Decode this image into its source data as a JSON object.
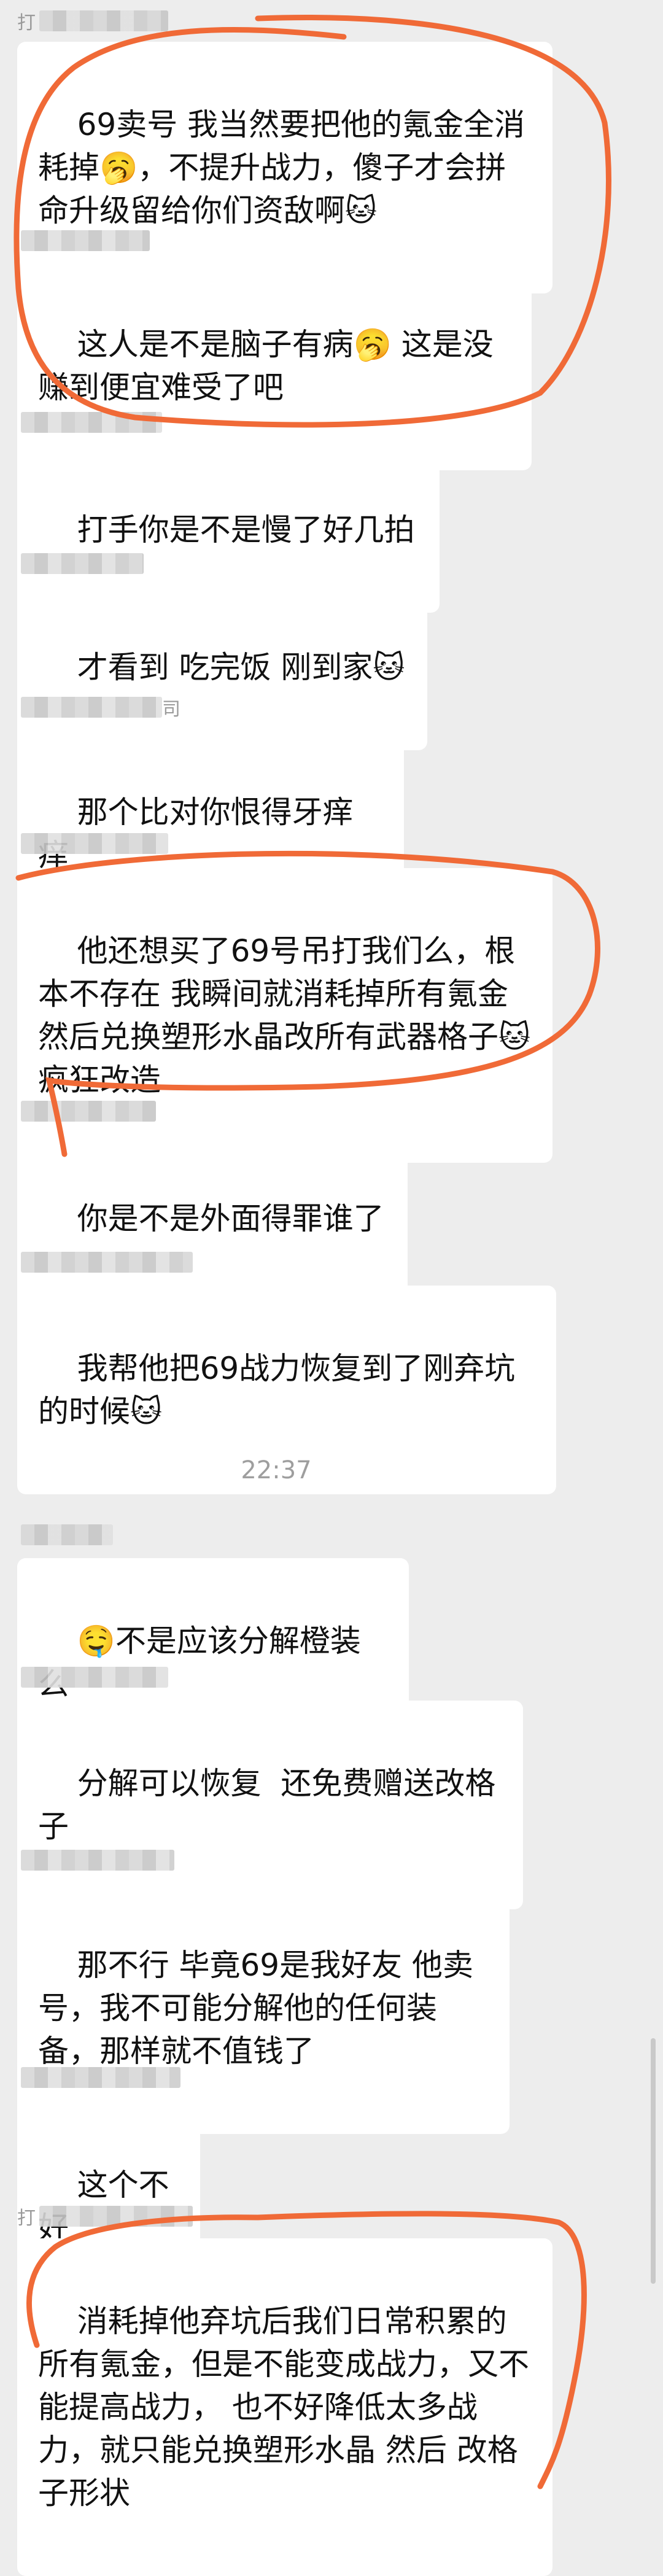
{
  "colors": {
    "background": "#ededed",
    "bubble": "#ffffff",
    "annotation": "#f06a37"
  },
  "timestamp": "22:37",
  "messages": [
    {
      "sender_visible": "打",
      "text": "69卖号 我当然要把他的氪金全消耗掉🥱，不提升战力，傻子才会拼命升级留给你们资敌啊🐱"
    },
    {
      "sender_visible": "",
      "text": "这人是不是脑子有病🥱 这是没赚到便宜难受了吧"
    },
    {
      "sender_visible": "",
      "text": "打手你是不是慢了好几拍"
    },
    {
      "sender_visible": "",
      "text": "才看到 吃完饭 刚到家🐱"
    },
    {
      "sender_visible": "司",
      "text": "那个比对你恨得牙痒痒"
    },
    {
      "sender_visible": "",
      "text": "他还想买了69号吊打我们么，根本不存在 我瞬间就消耗掉所有氪金 然后兑换塑形水晶改所有武器格子🐱疯狂改造"
    },
    {
      "sender_visible": "",
      "text": "你是不是外面得罪谁了"
    },
    {
      "sender_visible": "",
      "text": "我帮他把69战力恢复到了刚弃坑的时候🐱"
    },
    {
      "sender_visible": "",
      "text": "🤤不是应该分解橙装么"
    },
    {
      "sender_visible": "",
      "text": "分解可以恢复  还免费赠送改格子"
    },
    {
      "sender_visible": "",
      "text": "那不行 毕竟69是我好友 他卖号，我不可能分解他的任何装备，那样就不值钱了"
    },
    {
      "sender_visible": "",
      "text": "这个不好"
    },
    {
      "sender_visible": "打",
      "text": "消耗掉他弃坑后我们日常积累的所有氪金，但是不能变成战力，又不能提高战力， 也不好降低太多战力，就只能兑换塑形水晶 然后 改格子形状"
    }
  ]
}
